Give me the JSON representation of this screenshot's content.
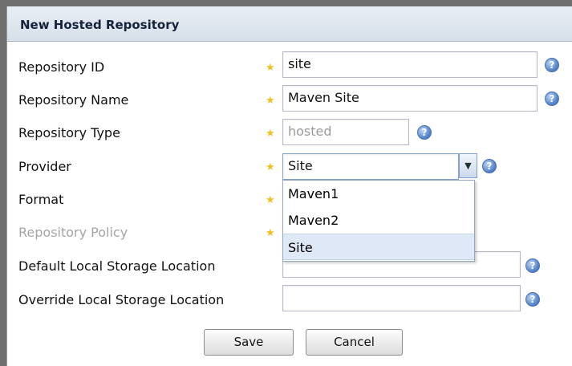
{
  "dialog": {
    "title": "New Hosted Repository"
  },
  "fields": {
    "repository_id": {
      "label": "Repository ID",
      "value": "site"
    },
    "repository_name": {
      "label": "Repository Name",
      "value": "Maven Site"
    },
    "repository_type": {
      "label": "Repository Type",
      "value": "hosted"
    },
    "provider": {
      "label": "Provider",
      "value": "Site",
      "options": [
        "Maven1",
        "Maven2",
        "Site"
      ]
    },
    "format": {
      "label": "Format"
    },
    "repository_policy": {
      "label": "Repository Policy"
    },
    "default_local_storage": {
      "label": "Default Local Storage Location",
      "value": ""
    },
    "override_local_storage": {
      "label": "Override Local Storage Location",
      "value": ""
    }
  },
  "buttons": {
    "save": "Save",
    "cancel": "Cancel"
  },
  "icons": {
    "required": "star-icon",
    "help": "help-icon",
    "dropdown": "chevron-down-icon"
  },
  "colors": {
    "header_bg": "#dfe6ef",
    "required_star": "#f0c020",
    "help_icon": "#4c7dc7",
    "selected_option": "#dfe8f6"
  }
}
